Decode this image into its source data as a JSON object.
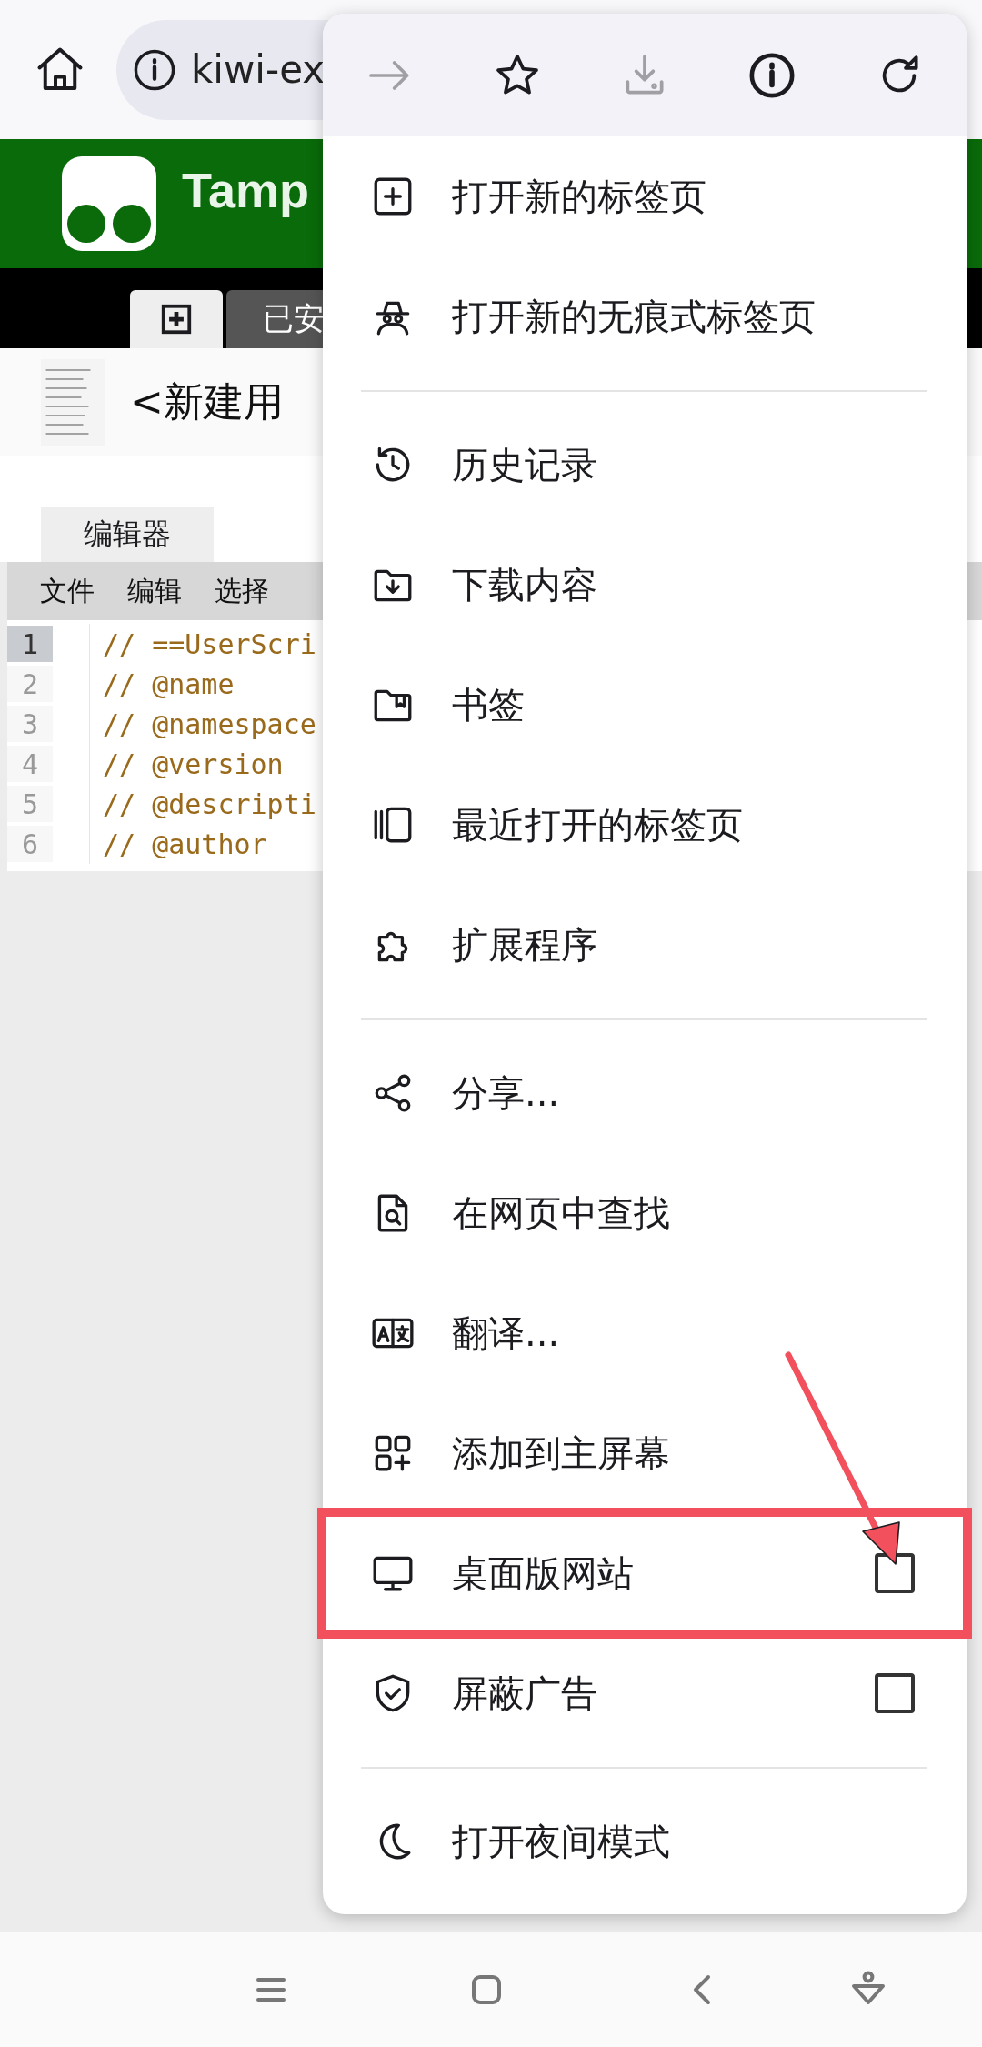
{
  "address_bar": {
    "url": "kiwi-ex"
  },
  "site_header": {
    "title": "Tamp"
  },
  "nav_tabs": [
    {
      "kind": "icon",
      "selected": true
    },
    {
      "kind": "text",
      "label": "已安",
      "selected": false
    }
  ],
  "script": {
    "title": "<新建用"
  },
  "editor_tabs": [
    {
      "label": "编辑器",
      "selected": true
    }
  ],
  "editor_menu": [
    "文件",
    "编辑",
    "选择"
  ],
  "code_lines": [
    {
      "number": "1",
      "text": "// ==UserScri",
      "current": true
    },
    {
      "number": "2",
      "text": "// @name",
      "current": false
    },
    {
      "number": "3",
      "text": "// @namespace",
      "current": false
    },
    {
      "number": "4",
      "text": "// @version",
      "current": false
    },
    {
      "number": "5",
      "text": "// @descripti",
      "current": false
    },
    {
      "number": "6",
      "text": "// @author",
      "current": false
    }
  ],
  "browser_menu": {
    "toolbar": [
      {
        "disabled": true
      },
      {
        "disabled": false
      },
      {
        "disabled": true
      },
      {
        "disabled": false
      },
      {
        "disabled": false
      }
    ],
    "sections": [
      {
        "items": [
          {
            "kind": "action",
            "label": "打开新的标签页",
            "highlighted": false
          },
          {
            "kind": "action",
            "label": "打开新的无痕式标签页",
            "highlighted": false
          }
        ]
      },
      {
        "items": [
          {
            "kind": "action",
            "label": "历史记录",
            "highlighted": false
          },
          {
            "kind": "action",
            "label": "下载内容",
            "highlighted": false
          },
          {
            "kind": "action",
            "label": "书签",
            "highlighted": false
          },
          {
            "kind": "action",
            "label": "最近打开的标签页",
            "highlighted": false
          },
          {
            "kind": "action",
            "label": "扩展程序",
            "highlighted": false
          }
        ]
      },
      {
        "items": [
          {
            "kind": "action",
            "label": "分享...",
            "highlighted": false
          },
          {
            "kind": "action",
            "label": "在网页中查找",
            "highlighted": false
          },
          {
            "kind": "action",
            "label": "翻译...",
            "highlighted": false
          },
          {
            "kind": "action",
            "label": "添加到主屏幕",
            "highlighted": false
          },
          {
            "kind": "checkbox",
            "label": "桌面版网站",
            "checked": false,
            "highlighted": true
          },
          {
            "kind": "checkbox",
            "label": "屏蔽广告",
            "checked": false,
            "highlighted": false
          }
        ]
      },
      {
        "items": [
          {
            "kind": "action",
            "label": "打开夜间模式",
            "highlighted": false
          }
        ]
      }
    ]
  }
}
